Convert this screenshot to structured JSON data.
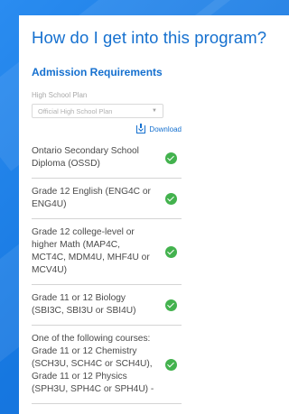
{
  "page": {
    "title": "How do I get into this program?",
    "section_heading": "Admission Requirements"
  },
  "high_school_plan": {
    "label": "High School Plan",
    "selected": "Official High School Plan"
  },
  "download": {
    "label": "Download",
    "icon": "download-icon"
  },
  "requirements": [
    {
      "text": "Ontario Secondary School Diploma (OSSD)",
      "status_icon": "check-circle-icon"
    },
    {
      "text": "Grade 12 English (ENG4C or ENG4U)",
      "status_icon": "check-circle-icon"
    },
    {
      "text": "Grade 12 college-level or higher Math (MAP4C, MCT4C, MDM4U, MHF4U or MCV4U)",
      "status_icon": "check-circle-icon"
    },
    {
      "text": "Grade 11 or 12 Biology (SBI3C, SBI3U or SBI4U)",
      "status_icon": "check-circle-icon"
    },
    {
      "text": "One of the following courses: Grade 11 or 12 Chemistry (SCH3U, SCH4C or SCH4U), Grade 11 or 12 Physics (SPH3U, SPH4C or SPH4U) -",
      "status_icon": "check-circle-icon"
    }
  ],
  "colors": {
    "accent": "#1570cf",
    "background": "#1f7fe6",
    "check": "#43b24e"
  }
}
